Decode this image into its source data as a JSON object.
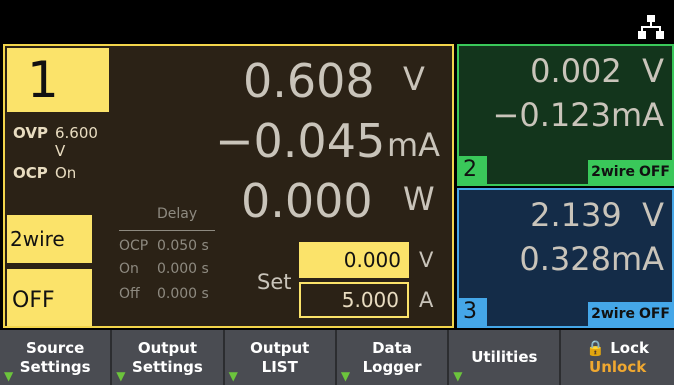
{
  "topbar": {
    "icon": "network-icon"
  },
  "ch1": {
    "number": "1",
    "ovp_label": "OVP",
    "ovp_value": "6.600 V",
    "ocp_label": "OCP",
    "ocp_value": "On",
    "voltage": "0.608",
    "voltage_unit": "V",
    "current": "−0.045",
    "current_unit": "mA",
    "power": "0.000",
    "power_unit": "W",
    "wire": "2wire",
    "output": "OFF",
    "delay_title": "Delay",
    "delay_ocp_label": "OCP",
    "delay_ocp_value": "0.050 s",
    "delay_on_label": "On",
    "delay_on_value": "0.000 s",
    "delay_off_label": "Off",
    "delay_off_value": "0.000 s",
    "set_label": "Set",
    "set_voltage": "0.000",
    "set_voltage_unit": "V",
    "set_current": "5.000",
    "set_current_unit": "A"
  },
  "ch2": {
    "number": "2",
    "voltage": "0.002",
    "voltage_unit": "V",
    "current": "−0.123",
    "current_unit": "mA",
    "wire": "2wire",
    "output": "OFF"
  },
  "ch3": {
    "number": "3",
    "voltage": "2.139",
    "voltage_unit": "V",
    "current": "0.328",
    "current_unit": "mA",
    "wire": "2wire",
    "output": "OFF"
  },
  "softkeys": [
    {
      "line1": "Source",
      "line2": "Settings"
    },
    {
      "line1": "Output",
      "line2": "Settings"
    },
    {
      "line1": "Output",
      "line2": "LIST"
    },
    {
      "line1": "Data",
      "line2": "Logger"
    },
    {
      "line1": "Utilities",
      "line2": ""
    },
    {
      "line1": "Lock",
      "line2": "Unlock"
    }
  ],
  "colors": {
    "ch1_accent": "#fbe36a",
    "ch2_accent": "#3ac85a",
    "ch3_accent": "#45a7e8",
    "softkey_bg": "#4a4c52",
    "unlock_text": "#f0a830"
  }
}
